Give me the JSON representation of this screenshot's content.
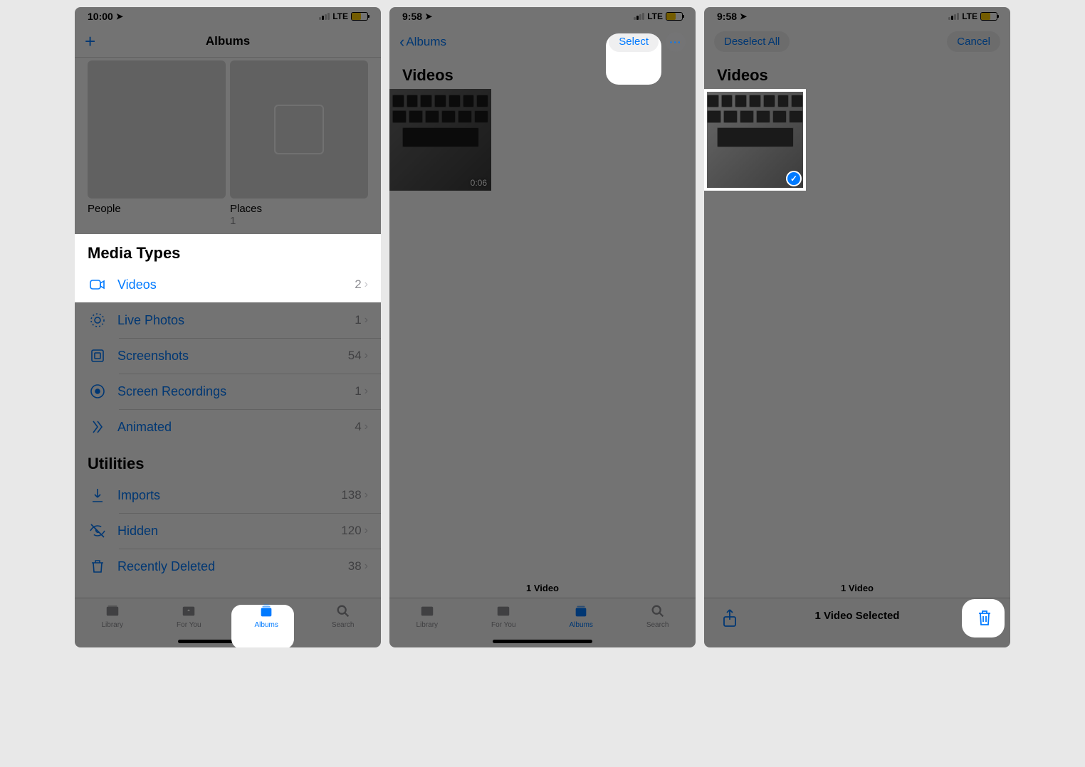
{
  "status": {
    "time_p1": "10:00",
    "time_p2": "9:58",
    "time_p3": "9:58",
    "network": "LTE"
  },
  "phone1": {
    "nav_title": "Albums",
    "albums": {
      "people": {
        "name": "People"
      },
      "places": {
        "name": "Places",
        "count": "1"
      }
    },
    "media_types_header": "Media Types",
    "media_types": [
      {
        "icon": "video",
        "label": "Videos",
        "count": "2"
      },
      {
        "icon": "livephoto",
        "label": "Live Photos",
        "count": "1"
      },
      {
        "icon": "screenshot",
        "label": "Screenshots",
        "count": "54"
      },
      {
        "icon": "recording",
        "label": "Screen Recordings",
        "count": "1"
      },
      {
        "icon": "animated",
        "label": "Animated",
        "count": "4"
      }
    ],
    "utilities_header": "Utilities",
    "utilities": [
      {
        "icon": "imports",
        "label": "Imports",
        "count": "138"
      },
      {
        "icon": "hidden",
        "label": "Hidden",
        "count": "120"
      },
      {
        "icon": "trash",
        "label": "Recently Deleted",
        "count": "38"
      }
    ]
  },
  "phone2": {
    "back_label": "Albums",
    "select_label": "Select",
    "title": "Videos",
    "thumb_duration": "0:06",
    "footer": "1 Video"
  },
  "phone3": {
    "deselect_label": "Deselect All",
    "cancel_label": "Cancel",
    "title": "Videos",
    "footer": "1 Video",
    "toolbar_center": "1 Video Selected"
  },
  "tabs": {
    "library": "Library",
    "for_you": "For You",
    "albums": "Albums",
    "search": "Search"
  }
}
